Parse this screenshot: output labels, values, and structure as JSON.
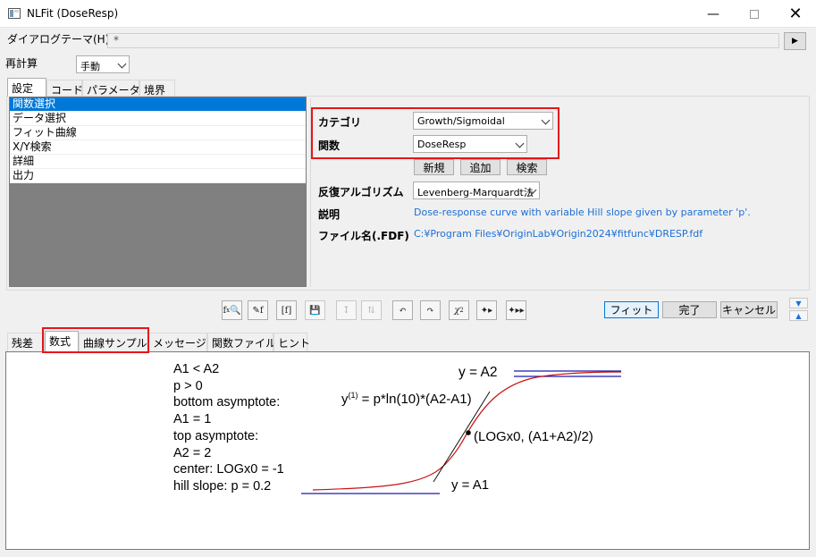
{
  "window": {
    "title": "NLFit (DoseResp)"
  },
  "dialog_theme": {
    "label": "ダイアログテーマ(H)",
    "value": "*"
  },
  "recalc": {
    "label": "再計算",
    "value": "手動"
  },
  "top_tabs": [
    "設定",
    "コード",
    "パラメータ",
    "境界"
  ],
  "settings_list": [
    "関数選択",
    "データ選択",
    "フィット曲線",
    "X/Y検索",
    "詳細",
    "出力"
  ],
  "function_panel": {
    "category_label": "カテゴリ",
    "category_value": "Growth/Sigmoidal",
    "function_label": "関数",
    "function_value": "DoseResp",
    "new_button": "新規",
    "add_button": "追加",
    "search_button": "検索",
    "algorithm_label": "反復アルゴリズム",
    "algorithm_value": "Levenberg-Marquardt法",
    "description_label": "説明",
    "description_value": "Dose-response curve with variable Hill slope given by parameter 'p'.",
    "filename_label": "ファイル名(.FDF)",
    "filename_value": "C:¥Program Files¥OriginLab¥Origin2024¥fitfunc¥DRESP.fdf"
  },
  "buttons": {
    "fit": "フィット",
    "done": "完了",
    "cancel": "キャンセル"
  },
  "bottom_tabs": [
    "残差",
    "数式",
    "曲線サンプル",
    "メッセージ",
    "関数ファイル",
    "ヒント"
  ],
  "formula_lines": [
    "A1 < A2",
    "p > 0",
    "bottom asymptote:",
    "A1 = 1",
    "top asymptote:",
    "A2 = 2",
    "center: LOGx0 = -1",
    "hill slope: p = 0.2"
  ],
  "graph_labels": {
    "top": "y = A2",
    "derivative_y": "y",
    "derivative_sup": "(1)",
    "derivative_rest": " = p*ln(10)*(A2-A1)",
    "midpoint": "(LOGx0, (A1+A2)/2)",
    "bottom": "y = A1"
  },
  "colors": {
    "selection": "#0078d7",
    "highlight": "#e8141b",
    "curve": "#cc1111",
    "asymptote": "#1a1ab0",
    "link_text": "#1c6fd6"
  }
}
